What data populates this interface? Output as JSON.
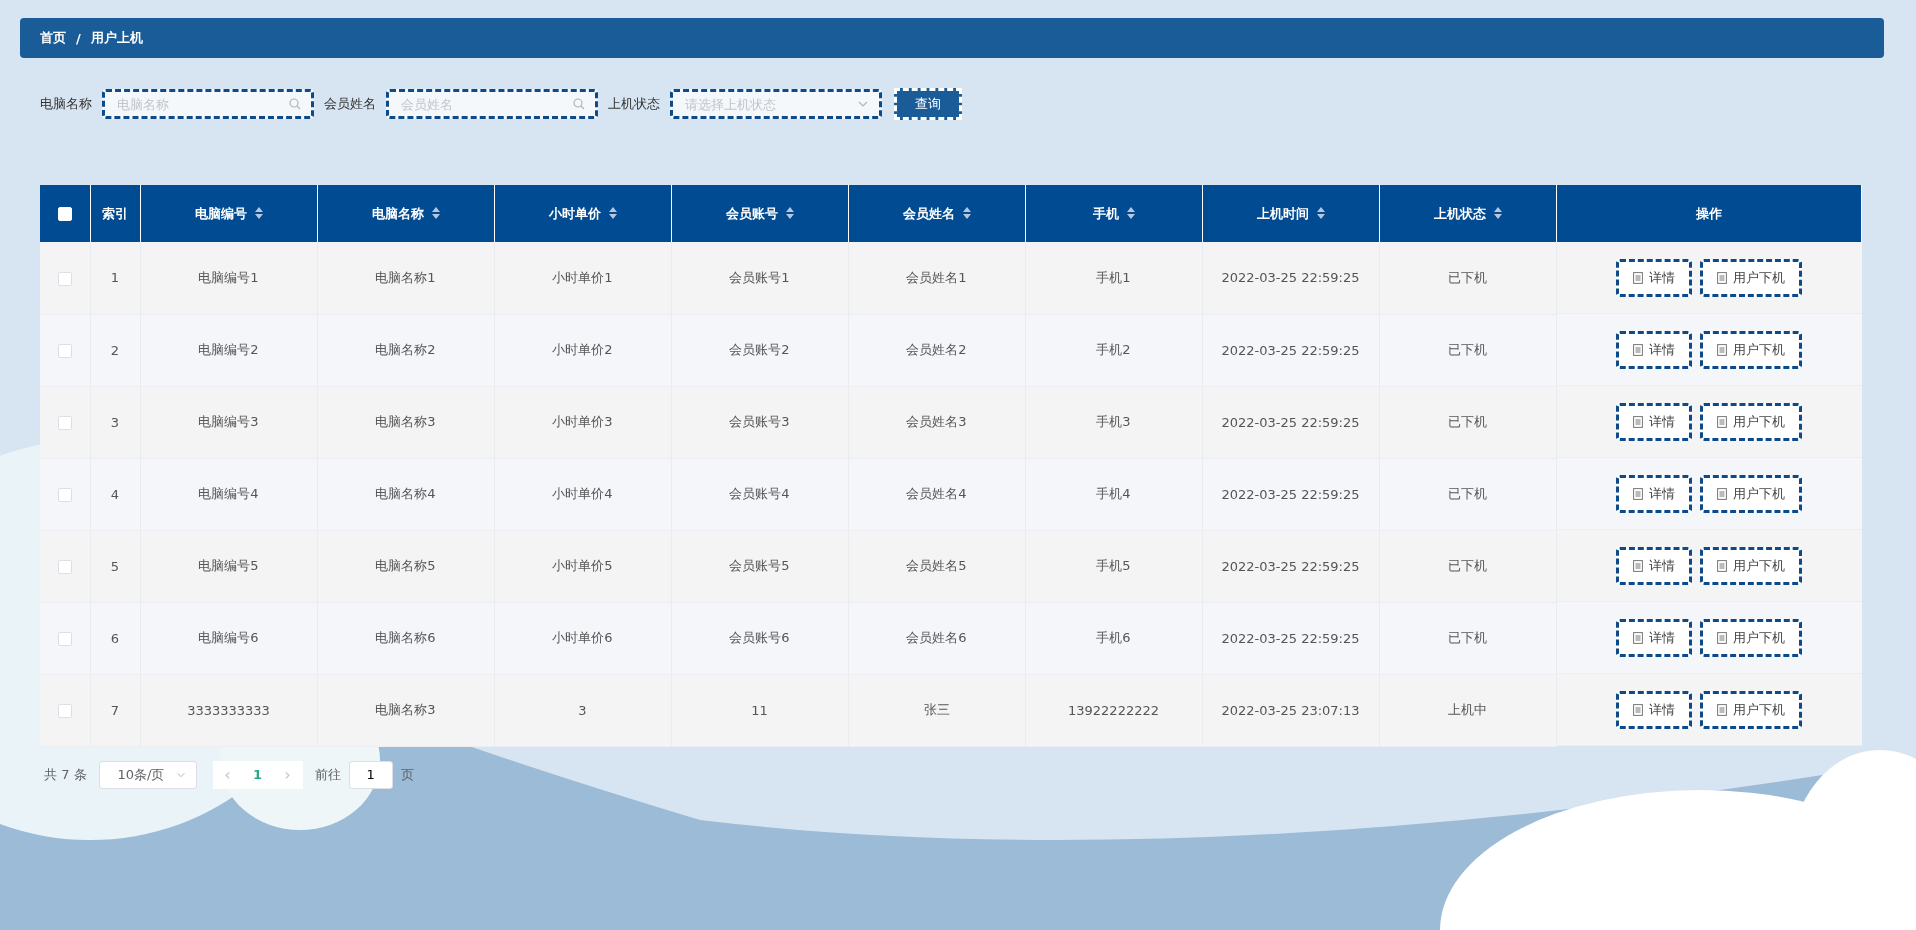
{
  "breadcrumb": [
    "首页",
    "/",
    "用户上机"
  ],
  "filters": [
    {
      "label": "电脑名称",
      "placeholder": "电脑名称",
      "kind": "search"
    },
    {
      "label": "会员姓名",
      "placeholder": "会员姓名",
      "kind": "search"
    },
    {
      "label": "上机状态",
      "placeholder": "请选择上机状态",
      "kind": "select"
    }
  ],
  "query_button": "查询",
  "table": {
    "select_all_checked": false,
    "columns": [
      {
        "label": "索引",
        "sortable": false
      },
      {
        "label": "电脑编号",
        "sortable": true
      },
      {
        "label": "电脑名称",
        "sortable": true
      },
      {
        "label": "小时单价",
        "sortable": true
      },
      {
        "label": "会员账号",
        "sortable": true
      },
      {
        "label": "会员姓名",
        "sortable": true
      },
      {
        "label": "手机",
        "sortable": true
      },
      {
        "label": "上机时间",
        "sortable": true
      },
      {
        "label": "上机状态",
        "sortable": true
      },
      {
        "label": "操作",
        "sortable": false
      }
    ],
    "rows": [
      {
        "checked": false,
        "cells": [
          "1",
          "电脑编号1",
          "电脑名称1",
          "小时单价1",
          "会员账号1",
          "会员姓名1",
          "手机1",
          "2022-03-25 22:59:25",
          "已下机"
        ],
        "actions": [
          "详情",
          "用户下机"
        ]
      },
      {
        "checked": false,
        "cells": [
          "2",
          "电脑编号2",
          "电脑名称2",
          "小时单价2",
          "会员账号2",
          "会员姓名2",
          "手机2",
          "2022-03-25 22:59:25",
          "已下机"
        ],
        "actions": [
          "详情",
          "用户下机"
        ]
      },
      {
        "checked": false,
        "cells": [
          "3",
          "电脑编号3",
          "电脑名称3",
          "小时单价3",
          "会员账号3",
          "会员姓名3",
          "手机3",
          "2022-03-25 22:59:25",
          "已下机"
        ],
        "actions": [
          "详情",
          "用户下机"
        ]
      },
      {
        "checked": false,
        "cells": [
          "4",
          "电脑编号4",
          "电脑名称4",
          "小时单价4",
          "会员账号4",
          "会员姓名4",
          "手机4",
          "2022-03-25 22:59:25",
          "已下机"
        ],
        "actions": [
          "详情",
          "用户下机"
        ]
      },
      {
        "checked": false,
        "cells": [
          "5",
          "电脑编号5",
          "电脑名称5",
          "小时单价5",
          "会员账号5",
          "会员姓名5",
          "手机5",
          "2022-03-25 22:59:25",
          "已下机"
        ],
        "actions": [
          "详情",
          "用户下机"
        ]
      },
      {
        "checked": false,
        "cells": [
          "6",
          "电脑编号6",
          "电脑名称6",
          "小时单价6",
          "会员账号6",
          "会员姓名6",
          "手机6",
          "2022-03-25 22:59:25",
          "已下机"
        ],
        "actions": [
          "详情",
          "用户下机"
        ]
      },
      {
        "checked": false,
        "cells": [
          "7",
          "3333333333",
          "电脑名称3",
          "3",
          "11",
          "张三",
          "13922222222",
          "2022-03-25 23:07:13",
          "上机中"
        ],
        "actions": [
          "详情",
          "用户下机"
        ]
      }
    ]
  },
  "pagination": {
    "total": "共 7 条",
    "page_size": "10条/页",
    "prev": "‹",
    "pages": [
      {
        "label": "1",
        "selected": true
      }
    ],
    "next": "›",
    "goto_label": "前往",
    "goto_value": "1",
    "goto_suffix": "页"
  }
}
